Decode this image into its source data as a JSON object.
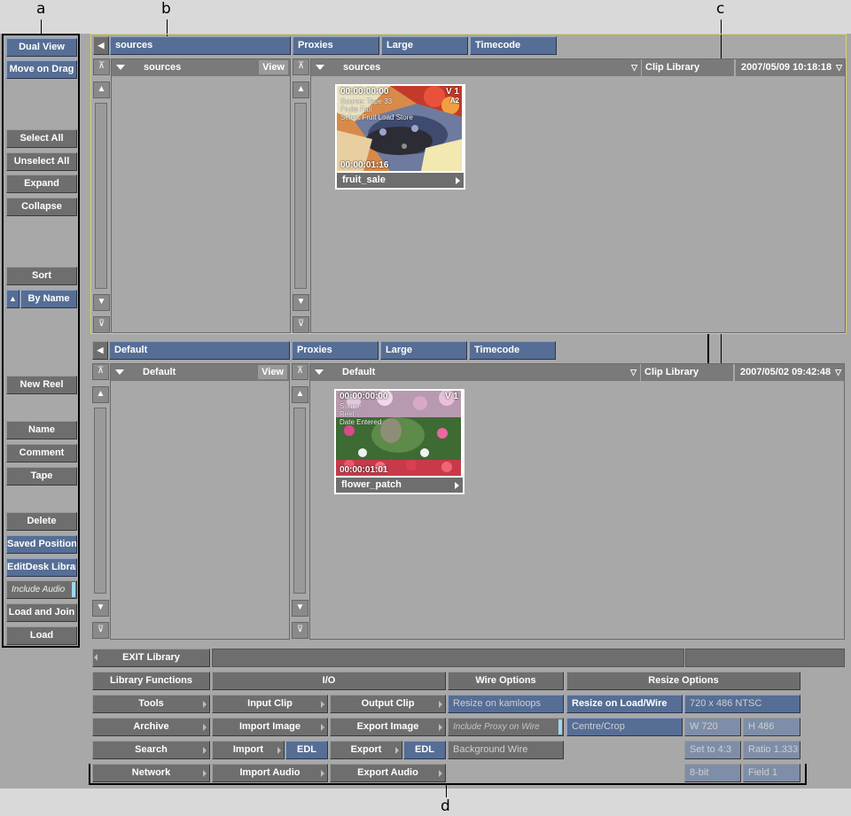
{
  "callouts": {
    "a": "a",
    "b": "b",
    "c": "c",
    "d": "d"
  },
  "sidebar": {
    "dual_view": "Dual View",
    "move_on_drag": "Move on Drag",
    "select_all": "Select All",
    "unselect_all": "Unselect All",
    "expand": "Expand",
    "collapse": "Collapse",
    "sort": "Sort",
    "by_name": "By Name",
    "new_reel": "New Reel",
    "name": "Name",
    "comment": "Comment",
    "tape": "Tape",
    "delete": "Delete",
    "saved_position": "Saved Position",
    "editdesk_library": "EditDesk Library",
    "include_audio": "Include Audio",
    "load_and_join": "Load and Join",
    "load": "Load"
  },
  "top_library": {
    "tab_name": "sources",
    "proxies": "Proxies",
    "large": "Large",
    "timecode": "Timecode",
    "tree_header": "sources",
    "view": "View",
    "clip_header": "sources",
    "clip_library": "Clip Library",
    "datetime": "2007/05/09 10:18:18",
    "clip": {
      "name": "fruit_sale",
      "tc_in": "00:00:00:00",
      "tc_out": "00:00:01:16",
      "overlay": [
        "Source: Tape 33",
        "Fruits Fall",
        "Select Fruit Load Store"
      ],
      "corner": "V 1",
      "corner2": "A2"
    }
  },
  "bottom_library": {
    "tab_name": "Default",
    "proxies": "Proxies",
    "large": "Large",
    "timecode": "Timecode",
    "tree_header": "Default",
    "view": "View",
    "clip_header": "Default",
    "clip_library": "Clip Library",
    "datetime": "2007/05/02 09:42:48",
    "clip": {
      "name": "flower_patch",
      "tc_in": "00:00:00:00",
      "tc_out": "00:00:01:01",
      "overlay": [
        "Source:",
        "Reel",
        "Date Entered"
      ],
      "corner": "V 1"
    }
  },
  "bottom": {
    "exit_library": "EXIT Library",
    "library_functions": "Library Functions",
    "io": "I/O",
    "wire_options": "Wire Options",
    "resize_options": "Resize Options",
    "tools": "Tools",
    "archive": "Archive",
    "search": "Search",
    "network": "Network",
    "input_clip": "Input Clip",
    "import_image": "Import Image",
    "import": "Import",
    "edl": "EDL",
    "import_audio": "Import Audio",
    "output_clip": "Output Clip",
    "export_image": "Export Image",
    "export": "Export",
    "edl2": "EDL",
    "export_audio": "Export Audio",
    "resize_on_kamloops": "Resize on kamloops",
    "include_proxy": "Include Proxy on Wire",
    "background_wire": "Background Wire",
    "resize_on_load": "Resize on Load/Wire",
    "centre_crop": "Centre/Crop",
    "resolution": "720 x 486 NTSC",
    "width": "W 720",
    "height": "H 486",
    "set_to": "Set to 4:3",
    "ratio": "Ratio 1.333",
    "bitdepth": "8-bit",
    "field": "Field 1"
  }
}
